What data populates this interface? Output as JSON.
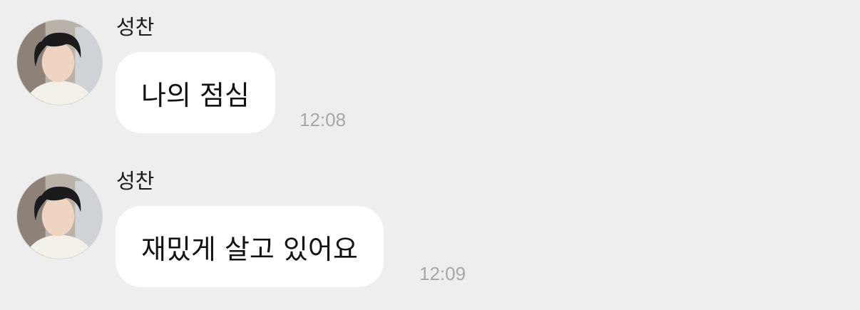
{
  "chat": {
    "messages": [
      {
        "sender": "성찬",
        "text": "나의 점심",
        "time": "12:08"
      },
      {
        "sender": "성찬",
        "text": "재밌게 살고 있어요",
        "time": "12:09"
      }
    ]
  },
  "colors": {
    "background": "#eeeeee",
    "bubble": "#ffffff",
    "timestamp": "#a7a7a7",
    "text": "#121212"
  }
}
